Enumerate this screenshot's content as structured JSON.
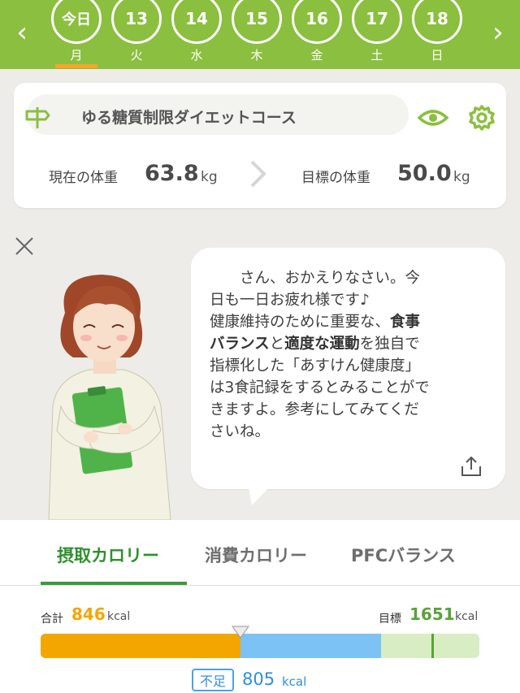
{
  "date_bar": {
    "prev_glyph": "‹",
    "next_glyph": "›",
    "days": [
      {
        "date": "今日",
        "weekday": "月",
        "selected": true
      },
      {
        "date": "13",
        "weekday": "火",
        "selected": false
      },
      {
        "date": "14",
        "weekday": "水",
        "selected": false
      },
      {
        "date": "15",
        "weekday": "木",
        "selected": false
      },
      {
        "date": "16",
        "weekday": "金",
        "selected": false
      },
      {
        "date": "17",
        "weekday": "土",
        "selected": false
      },
      {
        "date": "18",
        "weekday": "日",
        "selected": false
      }
    ]
  },
  "course": {
    "name": "ゆる糖質制限ダイエットコース",
    "current_weight_label": "現在の体重",
    "current_weight_value": "63.8",
    "current_weight_unit": "kg",
    "target_weight_label": "目標の体重",
    "target_weight_value": "50.0",
    "target_weight_unit": "kg"
  },
  "message": {
    "line1": "　　さん、おかえりなさい。今",
    "line2": "日も一日お疲れ様です♪",
    "line3a": "健康維持のために重要な、",
    "line3b": "食事",
    "line4a": "バランス",
    "line4b": "と",
    "line4c": "適度な運動",
    "line4d": "を独自で",
    "line5": "指標化した「あすけん健康度」",
    "line6": "は3食記録をするとみることがで",
    "line7": "きますよ。参考にしてみてくだ",
    "line8": "さいね。"
  },
  "tabs": {
    "intake": "摂取カロリー",
    "burned": "消費カロリー",
    "pfc": "PFCバランス"
  },
  "calories": {
    "total_label": "合計",
    "total_value": "846",
    "total_unit": "kcal",
    "goal_label": "目標",
    "goal_value": "1651",
    "goal_unit": "kcal",
    "deficit_badge": "不足",
    "deficit_value": "805",
    "deficit_unit": "kcal",
    "intake_fraction": 0.455,
    "goal_fraction": 0.775,
    "bar_colors": {
      "intake": "#f3a600",
      "short": "#7cc2f4",
      "remainder": "#d9edc4",
      "goal_line": "#57a338"
    }
  },
  "colors": {
    "brand_green": "#8bbf3f",
    "accent_orange": "#f3a62b",
    "tab_active": "#2f8f2f"
  }
}
